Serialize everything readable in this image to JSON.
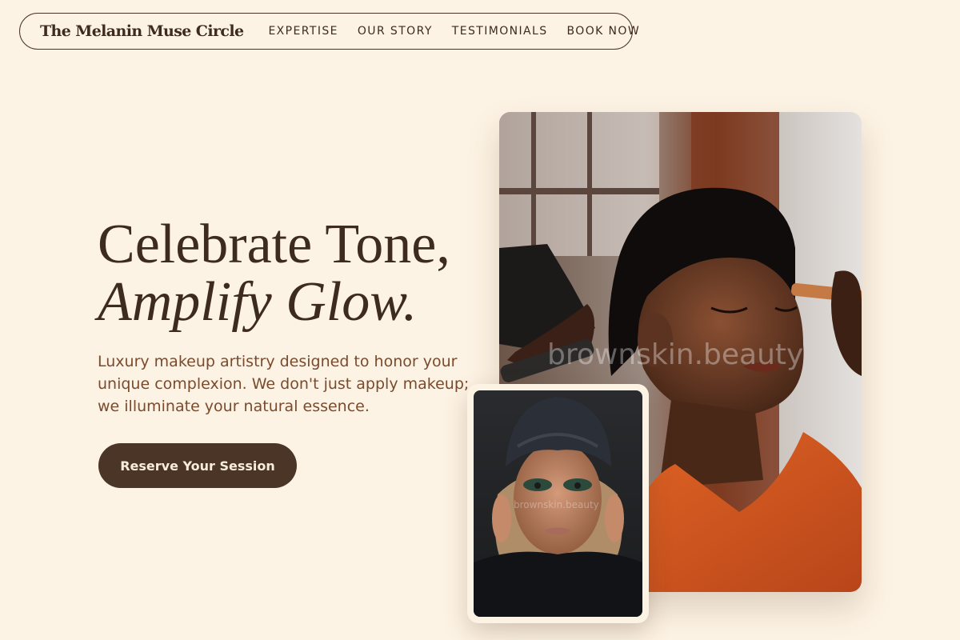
{
  "brand": {
    "name": "The Melanin Muse Circle"
  },
  "nav": {
    "links": [
      {
        "label": "EXPERTISE"
      },
      {
        "label": "OUR STORY"
      },
      {
        "label": "TESTIMONIALS"
      },
      {
        "label": "BOOK NOW"
      }
    ]
  },
  "hero": {
    "title_line1": "Celebrate Tone,",
    "title_line2": "Amplify Glow.",
    "subtitle": "Luxury makeup artistry designed to honor your unique complexion. We don't just apply makeup; we illuminate your natural essence.",
    "cta_label": "Reserve Your Session"
  },
  "images": {
    "main_watermark": "brownskin.beauty",
    "small_watermark": "brownskin.beauty"
  },
  "colors": {
    "background": "#fdf3e4",
    "primary_dark": "#4a3526",
    "heading": "#3d2b1f",
    "body_text": "#7a4a2c",
    "button_text": "#f8ecdb"
  }
}
